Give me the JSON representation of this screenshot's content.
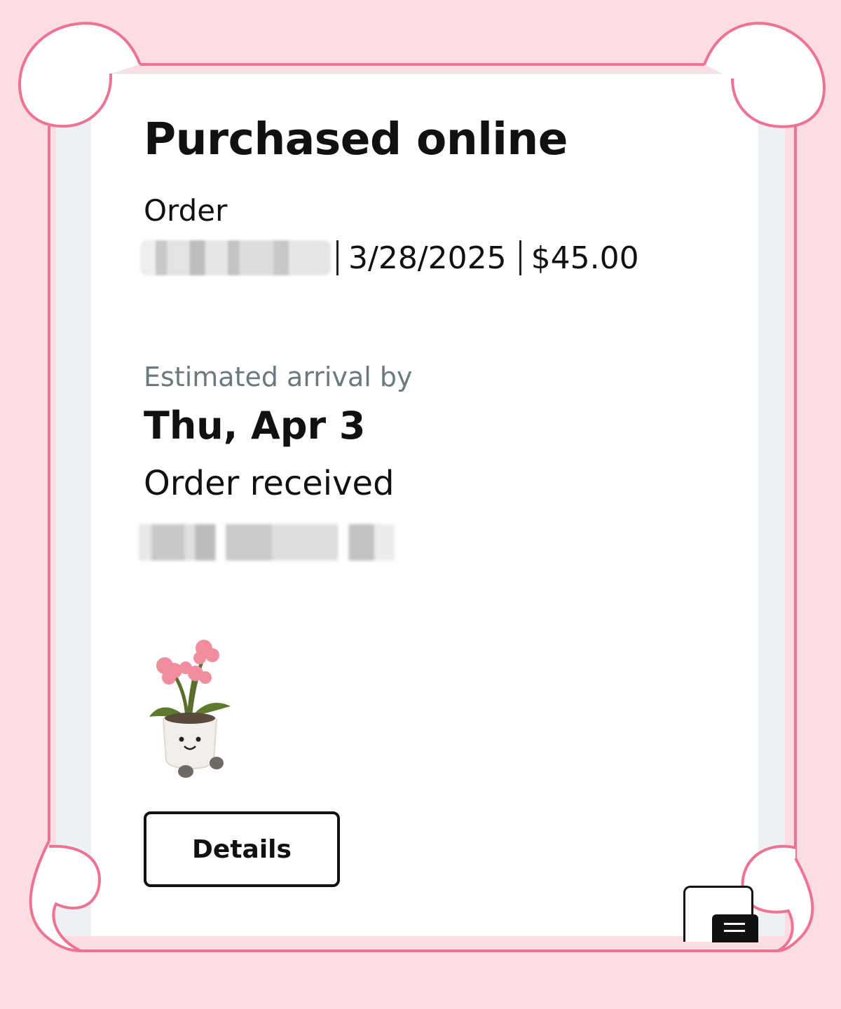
{
  "order": {
    "title": "Purchased online",
    "label": "Order",
    "date": "3/28/2025",
    "total": "$45.00"
  },
  "delivery": {
    "estimate_label": "Estimated arrival by",
    "estimate_date": "Thu, Apr 3",
    "status": "Order received"
  },
  "actions": {
    "details_label": "Details"
  },
  "colors": {
    "background": "#fcdde4",
    "frame_stroke": "#ee7392",
    "card": "#ffffff",
    "side_panel": "#edf1f4"
  },
  "icons": {
    "fab": "menu-icon",
    "product": "plush-flower-pot-image"
  }
}
